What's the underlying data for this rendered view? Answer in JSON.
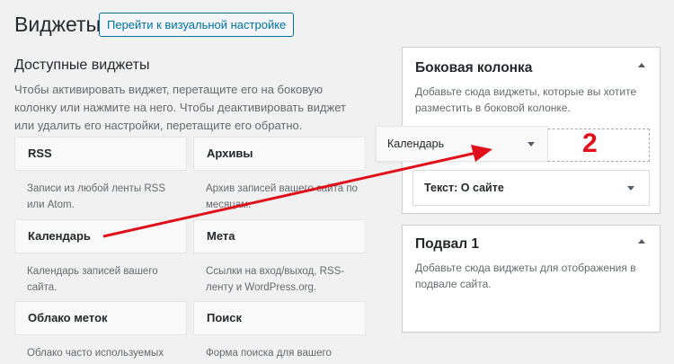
{
  "header": {
    "title": "Виджеты",
    "visual_button": "Перейти к визуальной настройке"
  },
  "available": {
    "title": "Доступные виджеты",
    "description": "Чтобы активировать виджет, перетащите его на боковую колонку или нажмите на него. Чтобы деактивировать виджет или удалить его настройки, перетащите его обратно.",
    "widgets": [
      {
        "title": "RSS",
        "desc": "Записи из любой ленты RSS или Atom."
      },
      {
        "title": "Архивы",
        "desc": "Архив записей вашего сайта по месяцам."
      },
      {
        "title": "Календарь",
        "desc": "Календарь записей вашего сайта."
      },
      {
        "title": "Мета",
        "desc": "Ссылки на вход/выход, RSS-ленту и WordPress.org."
      },
      {
        "title": "Облако меток",
        "desc": "Облако часто используемых"
      },
      {
        "title": "Поиск",
        "desc": "Форма поиска для вашего сайта."
      }
    ]
  },
  "sidebar": {
    "title": "Боковая колонка",
    "description": "Добавьте сюда виджеты, которые вы хотите разместить в боковой колонке.",
    "dragging_widget": "Календарь",
    "widget": "Текст: О сайте"
  },
  "footer_area": {
    "title": "Подвал 1",
    "description": "Добавьте сюда виджеты для отображения в подвале сайта."
  },
  "annotation": {
    "number": "2",
    "color": "#e0101a"
  }
}
